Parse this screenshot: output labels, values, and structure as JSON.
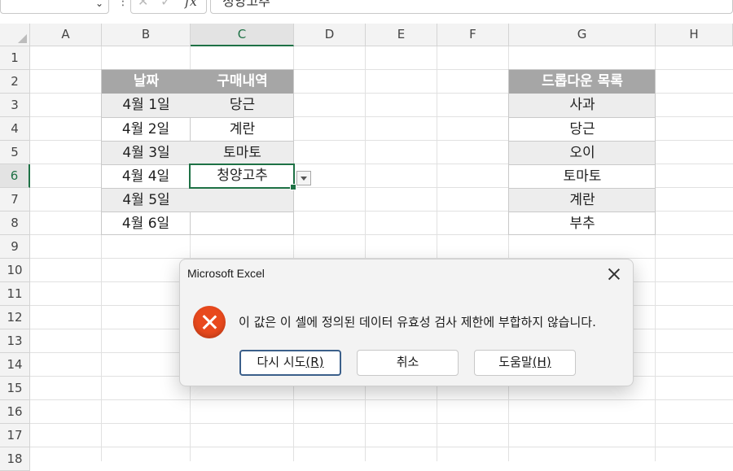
{
  "formula_bar": {
    "name_box_value": "",
    "cancel_icon": "close-icon",
    "enter_icon": "check-icon",
    "fx_label": "fx",
    "formula_value": "청양고추"
  },
  "columns": [
    "A",
    "B",
    "C",
    "D",
    "E",
    "F",
    "G",
    "H"
  ],
  "rows": [
    "1",
    "2",
    "3",
    "4",
    "5",
    "6",
    "7",
    "8",
    "9",
    "10",
    "11",
    "12",
    "13",
    "14",
    "15",
    "16",
    "17",
    "18"
  ],
  "selected_column": "C",
  "selected_row": "6",
  "table": {
    "header_date": "날짜",
    "header_item": "구매내역",
    "rows": [
      {
        "date": "4월 1일",
        "item": "당근"
      },
      {
        "date": "4월 2일",
        "item": "계란"
      },
      {
        "date": "4월 3일",
        "item": "토마토"
      },
      {
        "date": "4월 4일",
        "item": "청양고추"
      },
      {
        "date": "4월 5일",
        "item": ""
      },
      {
        "date": "4월 6일",
        "item": ""
      }
    ]
  },
  "dropdown_list": {
    "header": "드롭다운 목록",
    "items": [
      "사과",
      "당근",
      "오이",
      "토마토",
      "계란",
      "부추"
    ]
  },
  "colors": {
    "header_fill": "#a6a6a6",
    "band_fill": "#ededed",
    "accent_green": "#1e7145",
    "error_red": "#e8491d"
  },
  "dialog": {
    "title": "Microsoft Excel",
    "icon": "error-icon",
    "message": "이 값은 이 셀에 정의된 데이터 유효성 검사 제한에 부합하지 않습니다.",
    "retry_label": "다시 시도",
    "retry_key": "(R)",
    "cancel_label": "취소",
    "help_label": "도움말",
    "help_key": "(H)"
  }
}
